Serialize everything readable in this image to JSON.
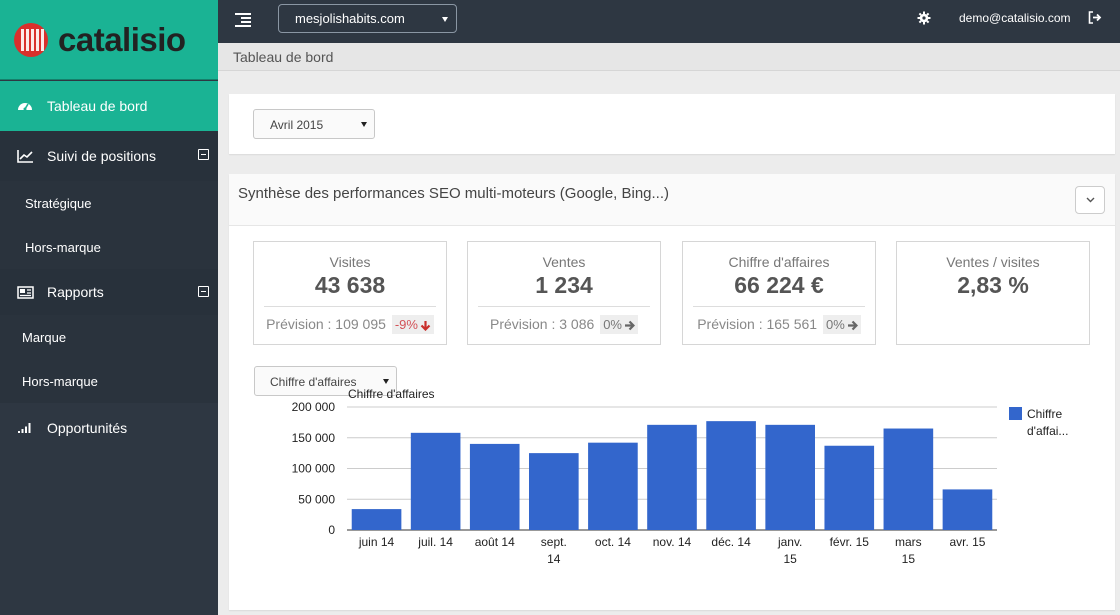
{
  "brand": {
    "name": "catalisio"
  },
  "sidebar": {
    "items": [
      {
        "label": "Tableau de bord",
        "icon": "dashboard-icon",
        "active": true
      },
      {
        "label": "Suivi de positions",
        "icon": "line-chart-icon",
        "expanded": true,
        "children": [
          {
            "label": "Stratégique"
          },
          {
            "label": "Hors-marque"
          }
        ]
      },
      {
        "label": "Rapports",
        "icon": "report-icon",
        "expanded": true,
        "children": [
          {
            "label": "Marque"
          },
          {
            "label": "Hors-marque"
          }
        ]
      },
      {
        "label": "Opportunités",
        "icon": "signal-icon"
      }
    ]
  },
  "topbar": {
    "site_select": "mesjolishabits.com",
    "user_email": "demo@catalisio.com"
  },
  "breadcrumb": "Tableau de bord",
  "period_select": "Avril 2015",
  "panel": {
    "title": "Synthèse des performances SEO multi-moteurs (Google, Bing...)"
  },
  "kpis": [
    {
      "label": "Visites",
      "value": "43 638",
      "forecast_label": "Prévision : 109 095",
      "delta": "-9%",
      "trend": "down"
    },
    {
      "label": "Ventes",
      "value": "1 234",
      "forecast_label": "Prévision : 3 086",
      "delta": "0%",
      "trend": "flat"
    },
    {
      "label": "Chiffre d'affaires",
      "value": "66 224 €",
      "forecast_label": "Prévision : 165 561",
      "delta": "0%",
      "trend": "flat"
    },
    {
      "label": "Ventes / visites",
      "value": "2,83 %"
    }
  ],
  "metric_select": "Chiffre d'affaires",
  "colors": {
    "accent": "#1ab394",
    "sidebar_bg": "#2e3742",
    "bar": "#3366cc",
    "negative": "#d35258"
  },
  "chart_data": {
    "type": "bar",
    "title": "Chiffre d'affaires",
    "categories": [
      [
        "juin 14"
      ],
      [
        "juil. 14"
      ],
      [
        "août 14"
      ],
      [
        "sept.",
        "14"
      ],
      [
        "oct. 14"
      ],
      [
        "nov. 14"
      ],
      [
        "déc. 14"
      ],
      [
        "janv.",
        "15"
      ],
      [
        "févr. 15"
      ],
      [
        "mars",
        "15"
      ],
      [
        "avr. 15"
      ]
    ],
    "series": [
      {
        "name": "Chiffre d'affaires",
        "legend_text": [
          "Chiffre",
          "d'affai..."
        ],
        "values": [
          34000,
          158000,
          140000,
          125000,
          142000,
          171000,
          177000,
          171000,
          137000,
          165000,
          66000
        ]
      }
    ],
    "yticks": [
      "200 000",
      "150 000",
      "100 000",
      "50 000",
      "0"
    ],
    "ylim": [
      0,
      200000
    ],
    "grid": true,
    "legend_position": "right"
  }
}
